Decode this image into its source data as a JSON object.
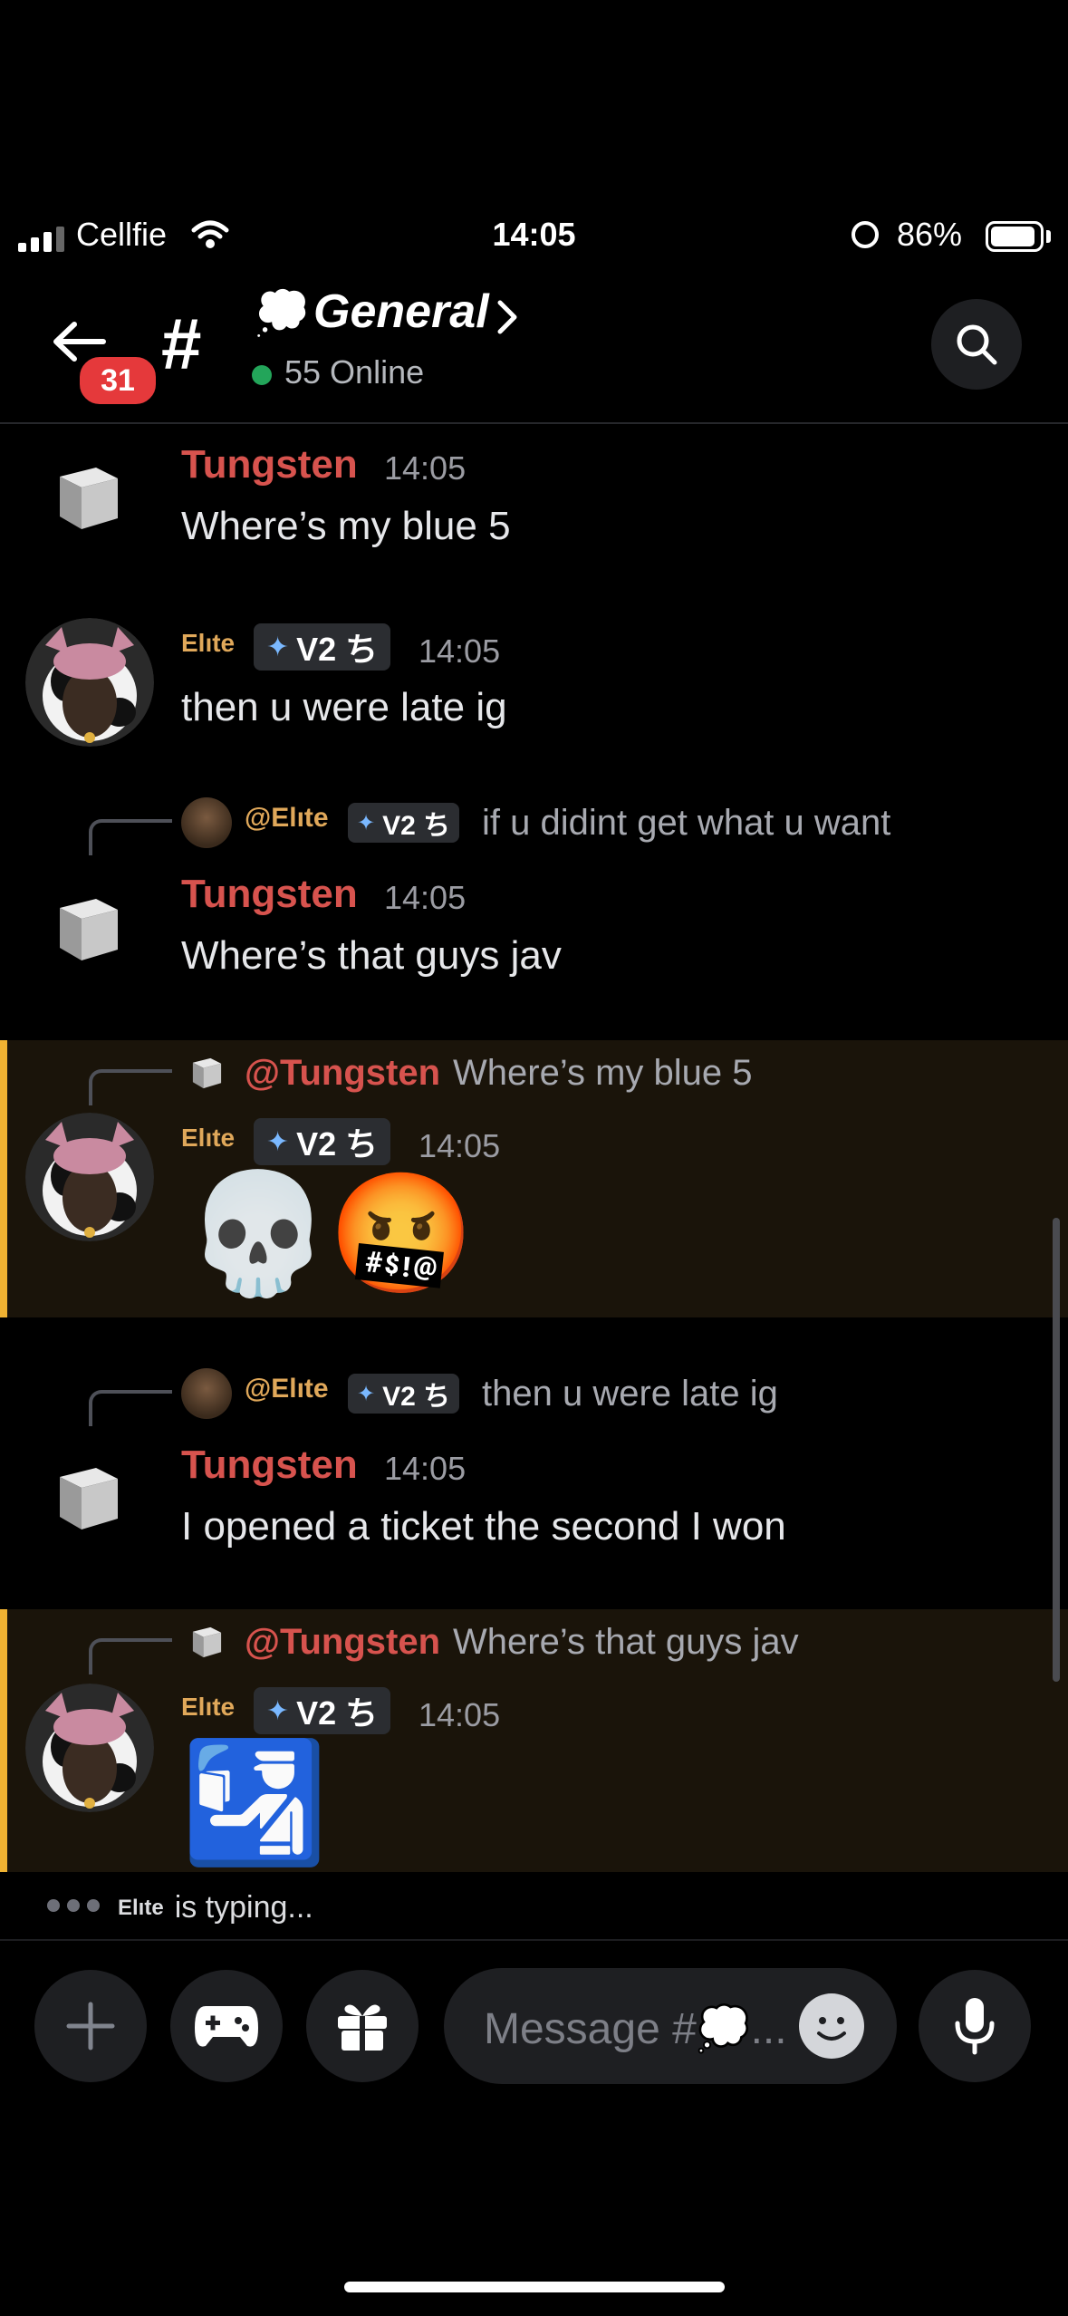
{
  "status_bar": {
    "carrier": "Cellfie",
    "time": "14:05",
    "battery_pct": "86%"
  },
  "header": {
    "back_badge": "31",
    "channel_emoji": "💭",
    "channel_name": "General",
    "online": "55 Online"
  },
  "messages": [
    {
      "author": "Tungsten",
      "time": "14:05",
      "text": "Where’s my blue 5"
    },
    {
      "author": "Elıte",
      "tag": "V2 ち",
      "time": "14:05",
      "text": "then u were late ig"
    },
    {
      "reply_to": "@Elıte",
      "reply_tag": "V2 ち",
      "reply_text": "if u didint get what u want",
      "author": "Tungsten",
      "time": "14:05",
      "text": "Where’s that guys jav"
    },
    {
      "reply_to": "@Tungsten",
      "reply_text": "Where’s my blue 5",
      "author": "Elıte",
      "tag": "V2 ち",
      "time": "14:05",
      "emojis": [
        "💀",
        "🤬"
      ]
    },
    {
      "reply_to": "@Elıte",
      "reply_tag": "V2 ち",
      "reply_text": "then u were late ig",
      "author": "Tungsten",
      "time": "14:05",
      "text": "I opened a ticket the second I won"
    },
    {
      "reply_to": "@Tungsten",
      "reply_text": "Where’s that guys jav",
      "author": "Elıte",
      "tag": "V2 ち",
      "time": "14:05",
      "emojis": [
        "🛂"
      ]
    }
  ],
  "typing": {
    "name": "Elıte",
    "text": "is typing..."
  },
  "composer": {
    "placeholder": "Message #💭..."
  },
  "colors": {
    "accent_name": "#d7534e",
    "highlight_bar": "#f0b232",
    "online": "#23a55a"
  }
}
